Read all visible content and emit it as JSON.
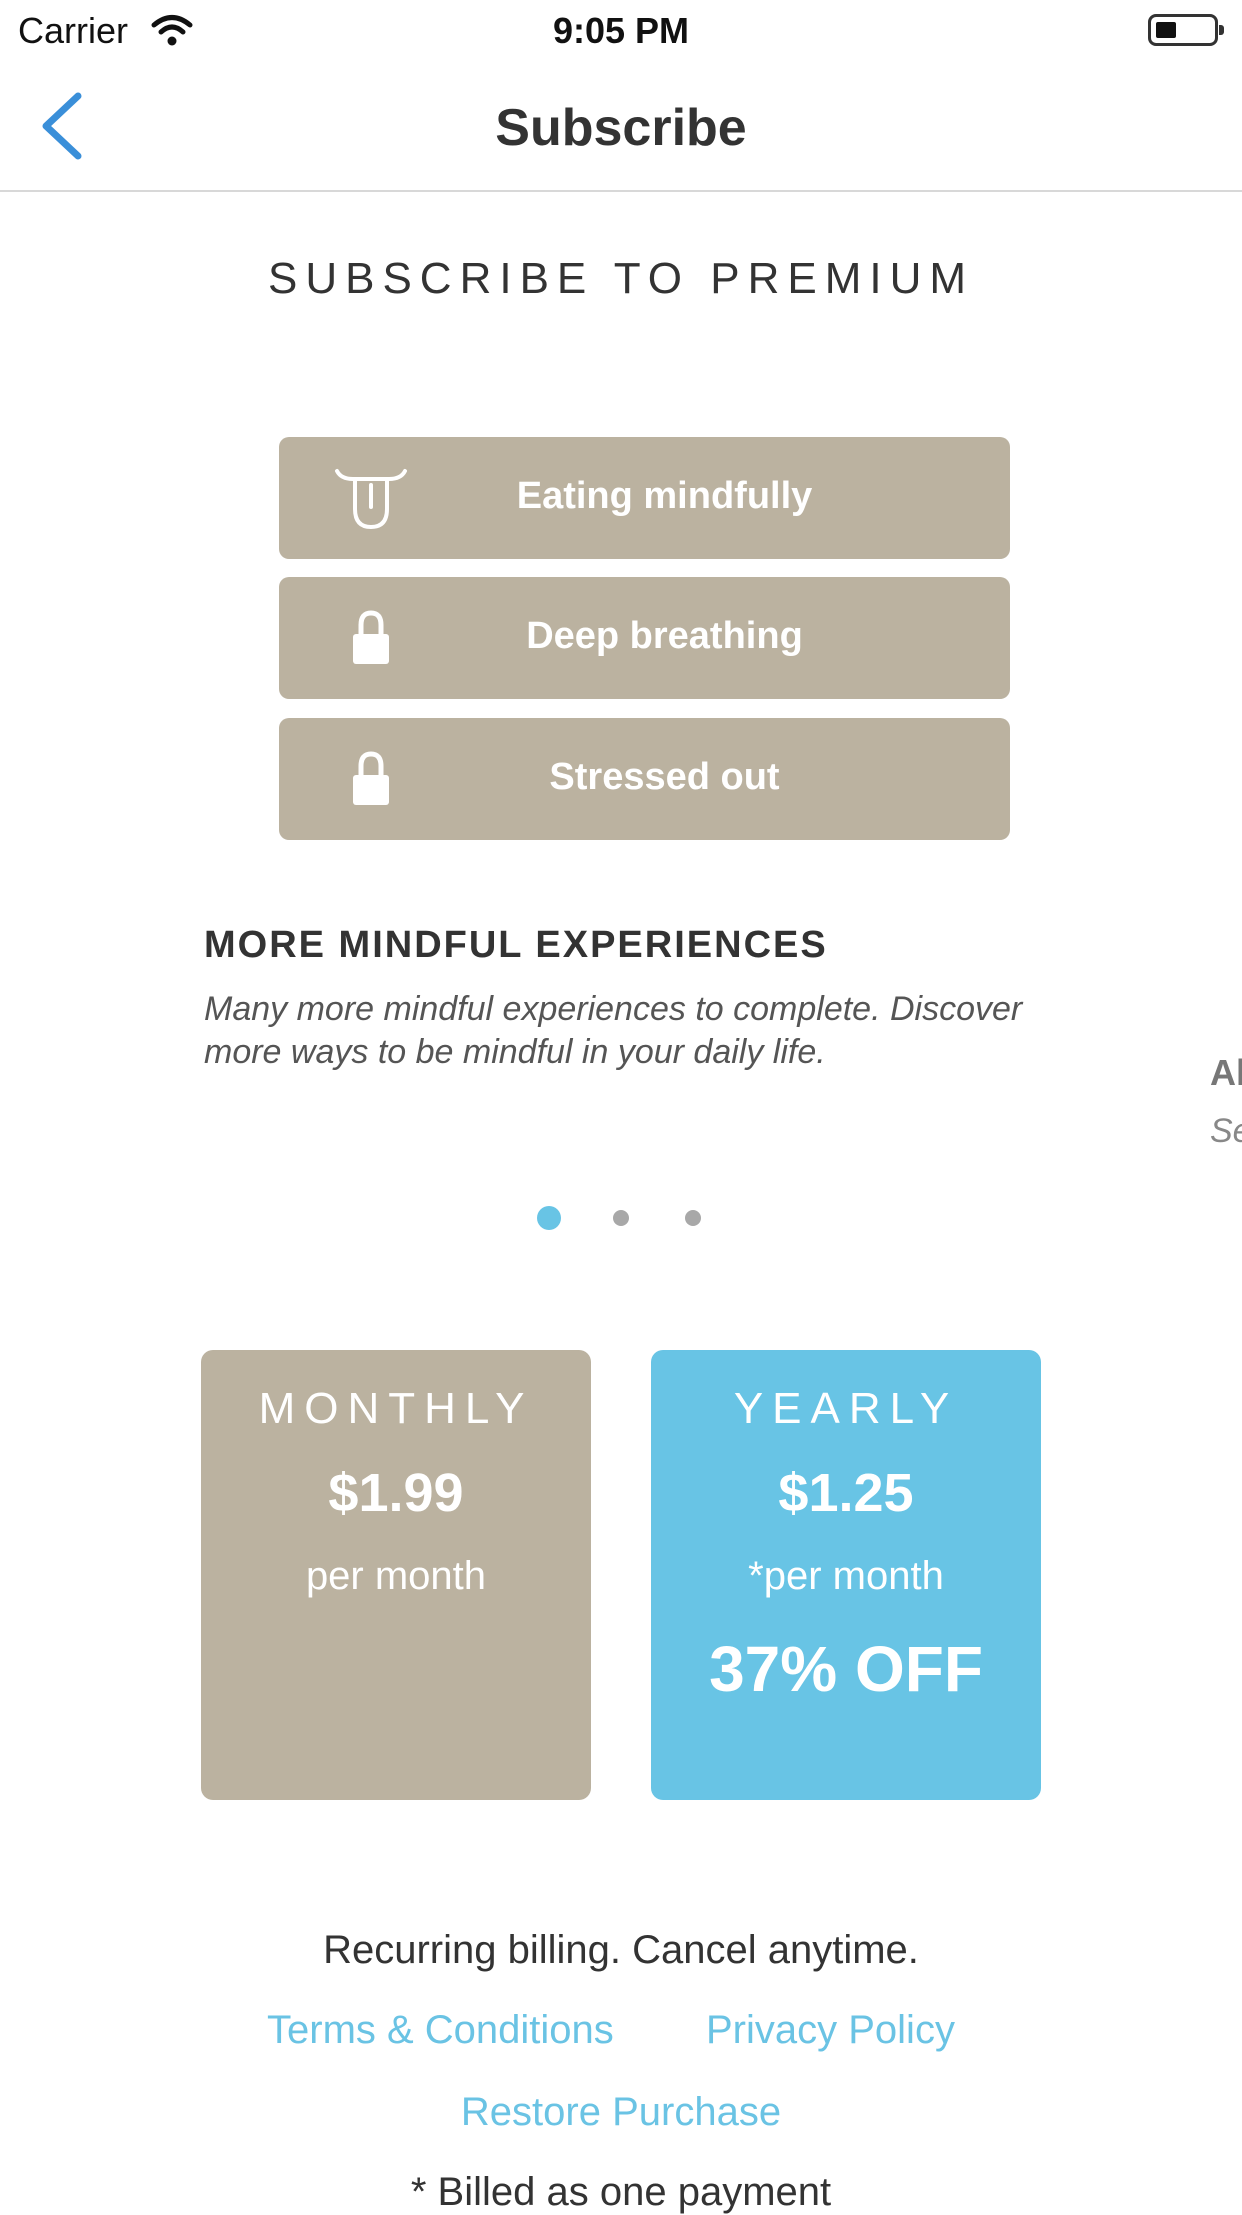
{
  "status_bar": {
    "carrier": "Carrier",
    "time": "9:05 PM",
    "battery_level": 0.25
  },
  "nav": {
    "title": "Subscribe"
  },
  "heading": "SUBSCRIBE TO PREMIUM",
  "experiences": [
    {
      "label": "Eating mindfully",
      "icon": "tongue-icon",
      "locked": false
    },
    {
      "label": "Deep breathing",
      "icon": "lock-icon",
      "locked": true
    },
    {
      "label": "Stressed out",
      "icon": "lock-icon",
      "locked": true
    }
  ],
  "promo": {
    "title": "MORE MINDFUL EXPERIENCES",
    "text": "Many more mindful experiences to complete. Discover more ways to be mindful in your daily life.",
    "next_title_peek": "Al",
    "next_text_peek": "Se"
  },
  "pager": {
    "current": 1,
    "total": 3
  },
  "plans": {
    "monthly": {
      "name": "MONTHLY",
      "price": "$1.99",
      "period": "per month"
    },
    "yearly": {
      "name": "YEARLY",
      "price": "$1.25",
      "period": "*per month",
      "discount": "37% OFF"
    }
  },
  "footer": {
    "billing_note": "Recurring billing. Cancel anytime.",
    "terms": "Terms & Conditions",
    "privacy": "Privacy Policy",
    "restore": "Restore Purchase",
    "footnote": "* Billed as one payment"
  },
  "colors": {
    "card_tan": "#bbb2a0",
    "accent_blue": "#68c4e5",
    "link_blue": "#6ac3e4",
    "back_blue": "#3a8fd9"
  }
}
